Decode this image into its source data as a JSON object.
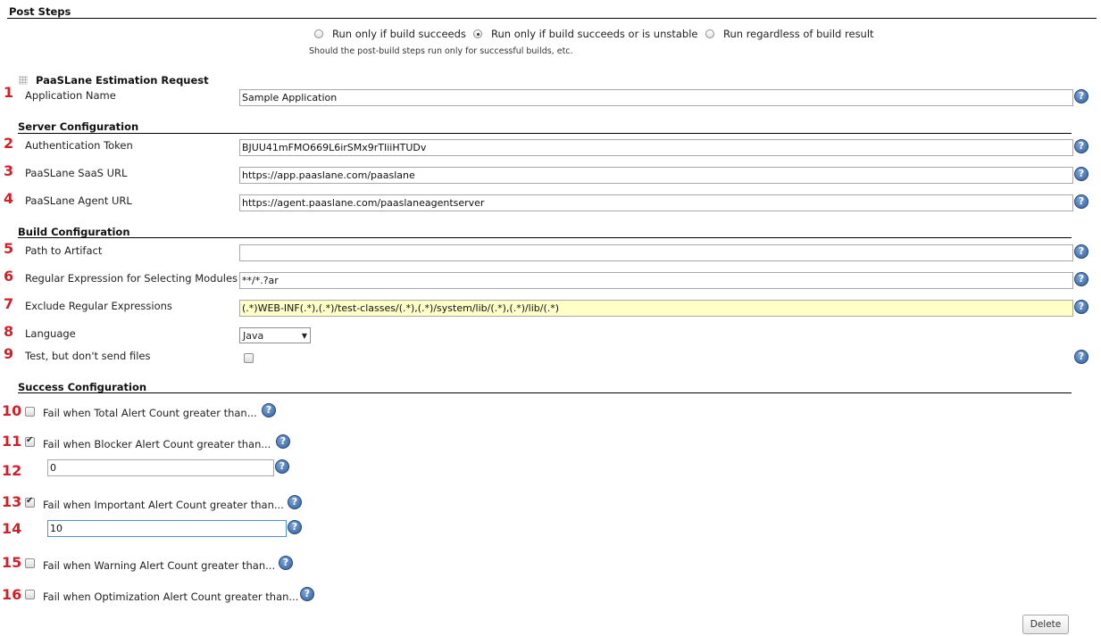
{
  "post_steps": {
    "title": "Post Steps",
    "options": [
      {
        "label": "Run only if build succeeds",
        "selected": false
      },
      {
        "label": "Run only if build succeeds or is unstable",
        "selected": true
      },
      {
        "label": "Run regardless of build result",
        "selected": false
      }
    ],
    "hint": "Should the post-build steps run only for successful builds, etc."
  },
  "step": {
    "title": "PaaSLane Estimation Request"
  },
  "markers": [
    "1",
    "2",
    "3",
    "4",
    "5",
    "6",
    "7",
    "8",
    "9",
    "10",
    "11",
    "12",
    "13",
    "14",
    "15",
    "16"
  ],
  "app": {
    "label": "Application Name",
    "value": "Sample Application"
  },
  "server": {
    "title": "Server Configuration",
    "token_label": "Authentication Token",
    "token_value": "BJUU41mFMO669L6irSMx9rTIiiHTUDv",
    "saas_label": "PaaSLane SaaS URL",
    "saas_value": "https://app.paaslane.com/paaslane",
    "agent_label": "PaaSLane Agent URL",
    "agent_value": "https://agent.paaslane.com/paaslaneagentserver"
  },
  "build": {
    "title": "Build Configuration",
    "artifact_label": "Path to Artifact",
    "artifact_value": "",
    "regex_label": "Regular Expression for Selecting Modules",
    "regex_value": "**/*.?ar",
    "exclude_label": "Exclude Regular Expressions",
    "exclude_value": "(.*)WEB-INF(.*),(.*)/test-classes/(.*),(.*)/system/lib/(.*),(.*)/lib/(.*)",
    "language_label": "Language",
    "language_value": "Java",
    "test_label": "Test, but don't send files",
    "test_checked": false
  },
  "success": {
    "title": "Success Configuration",
    "total_label": "Fail when Total Alert Count greater than...",
    "total_checked": false,
    "blocker_label": "Fail when Blocker Alert Count greater than...",
    "blocker_checked": true,
    "blocker_value": "0",
    "important_label": "Fail when Important Alert Count greater than...",
    "important_checked": true,
    "important_value": "10",
    "warning_label": "Fail when Warning Alert Count greater than...",
    "warning_checked": false,
    "optimization_label": "Fail when Optimization Alert Count greater than...",
    "optimization_checked": false
  },
  "help_glyph": "?",
  "delete_label": "Delete",
  "colors": {
    "marker": "#d0202a",
    "highlight_field": "#ffffc8",
    "help_icon": "#2e5f9e"
  }
}
